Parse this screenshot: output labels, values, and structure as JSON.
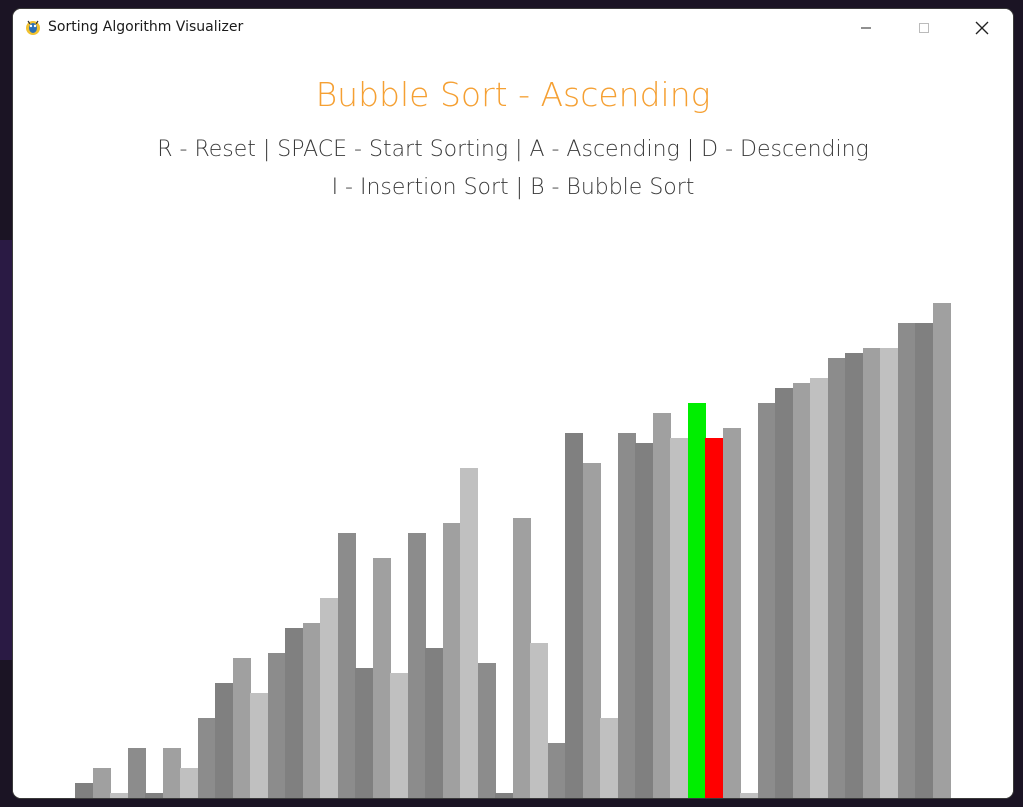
{
  "window": {
    "title": "Sorting Algorithm Visualizer"
  },
  "app": {
    "heading": "Bubble Sort - Ascending",
    "help_line_1": "R - Reset | SPACE - Start Sorting | A - Ascending | D - Descending",
    "help_line_2": "I - Insertion Sort | B - Bubble Sort"
  },
  "colors": {
    "heading": "#f5a033",
    "compare_a": "#00ee00",
    "compare_b": "#ff0000",
    "bar_shades": [
      "#808080",
      "#a0a0a0",
      "#c0c0c0",
      "#8c8c8c"
    ]
  },
  "icons": {
    "app": "pygame-snake-icon",
    "minimize": "minimize-icon",
    "maximize": "maximize-icon",
    "close": "close-icon"
  },
  "chart_data": {
    "type": "bar",
    "values": [
      3,
      6,
      1,
      10,
      0,
      10,
      6,
      16,
      23,
      28,
      21,
      29,
      34,
      35,
      40,
      53,
      26,
      48,
      25,
      53,
      30,
      55,
      66,
      27,
      0,
      56,
      31,
      11,
      73,
      67,
      16,
      73,
      71,
      77,
      72,
      79,
      72,
      74,
      0,
      79,
      82,
      83,
      84,
      88,
      89,
      90,
      90,
      95,
      95,
      99
    ],
    "highlight": [
      {
        "index": 35,
        "role": "compare",
        "color": "#00ee00"
      },
      {
        "index": 36,
        "role": "compare",
        "color": "#ff0000"
      }
    ],
    "ylim": [
      0,
      100
    ]
  }
}
